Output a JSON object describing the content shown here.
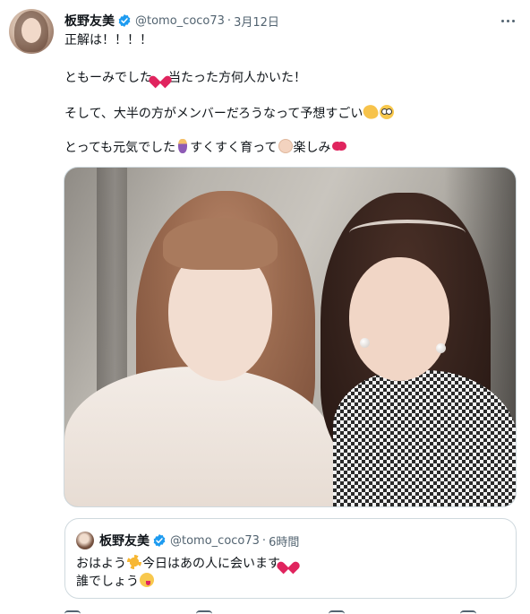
{
  "tweet": {
    "display_name": "板野友美",
    "handle": "@tomo_coco73",
    "separator": "·",
    "date": "3月12日",
    "lines": {
      "l1": "正解は！！！！",
      "l2a": "ともーみでした",
      "l2b": "当たった方何人かいた！",
      "l3a": "そして、大半の方がメンバーだろうなって予想すごい",
      "l4a": "とっても元気でした",
      "l4b": "すくすく育って",
      "l4c": "楽しみ"
    },
    "emojis": {
      "l2": "heart-icon",
      "l3a": "clapping-hands-icon",
      "l3b": "flushed-face-icon",
      "l4a": "pregnant-woman-icon",
      "l4b": "baby-icon",
      "l4c": "ribbon-icon"
    },
    "verified_color": "#1d9bf0"
  },
  "quoted": {
    "display_name": "板野友美",
    "handle": "@tomo_coco73",
    "separator": "·",
    "time": "6時間",
    "line1a": "おはよう",
    "line1b": "今日はあの人に会います",
    "line2": "誰でしょう",
    "emojis": [
      "sun-icon",
      "heart-icon",
      "yum-face-icon"
    ]
  }
}
